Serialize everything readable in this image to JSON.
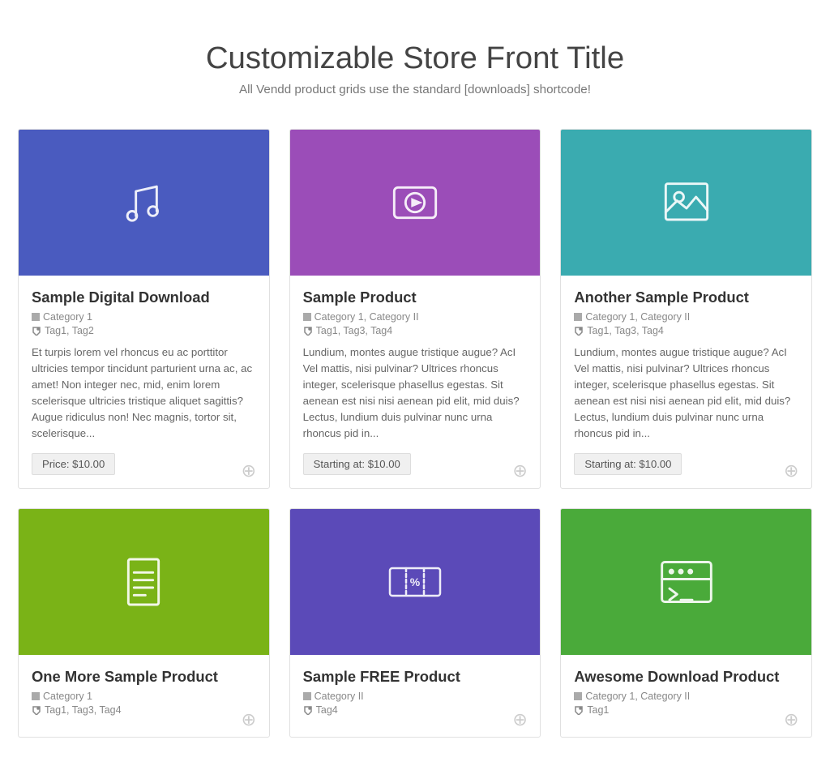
{
  "header": {
    "title": "Customizable Store Front Title",
    "subtitle": "All Vendd product grids use the standard [downloads] shortcode!"
  },
  "products": [
    {
      "id": "sample-digital-download",
      "name": "Sample Digital Download",
      "categories": "Category 1",
      "tags": "Tag1, Tag2",
      "description": "Et turpis lorem vel rhoncus eu ac porttitor ultricies tempor tincidunt parturient urna ac, ac amet! Non integer nec, mid, enim lorem scelerisque ultricies tristique aliquet sagittis? Augue ridiculus non! Nec magnis, tortor sit, scelerisque...",
      "price": "Price: $10.00",
      "thumbnailClass": "thumb-blue",
      "icon": "music"
    },
    {
      "id": "sample-product",
      "name": "Sample Product",
      "categories": "Category 1, Category II",
      "tags": "Tag1, Tag3, Tag4",
      "description": "Lundium, montes augue tristique augue? AcI Vel mattis, nisi pulvinar? Ultrices rhoncus integer, scelerisque phasellus egestas. Sit aenean est nisi nisi aenean pid elit, mid duis? Lectus, lundium duis pulvinar nunc urna rhoncus pid in...",
      "price": "Starting at: $10.00",
      "thumbnailClass": "thumb-purple",
      "icon": "video"
    },
    {
      "id": "another-sample-product",
      "name": "Another Sample Product",
      "categories": "Category 1, Category II",
      "tags": "Tag1, Tag3, Tag4",
      "description": "Lundium, montes augue tristique augue? AcI Vel mattis, nisi pulvinar? Ultrices rhoncus integer, scelerisque phasellus egestas. Sit aenean est nisi nisi aenean pid elit, mid duis? Lectus, lundium duis pulvinar nunc urna rhoncus pid in...",
      "price": "Starting at: $10.00",
      "thumbnailClass": "thumb-teal",
      "icon": "image"
    },
    {
      "id": "one-more-sample-product",
      "name": "One More Sample Product",
      "categories": "Category 1",
      "tags": "Tag1, Tag3, Tag4",
      "description": "",
      "price": "",
      "thumbnailClass": "thumb-green",
      "icon": "document"
    },
    {
      "id": "sample-free-product",
      "name": "Sample FREE Product",
      "categories": "Category II",
      "tags": "Tag4",
      "description": "",
      "price": "",
      "thumbnailClass": "thumb-violet",
      "icon": "ticket"
    },
    {
      "id": "awesome-download-product",
      "name": "Awesome Download Product",
      "categories": "Category 1, Category II",
      "tags": "Tag1",
      "description": "",
      "price": "",
      "thumbnailClass": "thumb-green2",
      "icon": "terminal"
    }
  ],
  "icons": {
    "category": "▪",
    "tag": "♦",
    "add": "+"
  }
}
